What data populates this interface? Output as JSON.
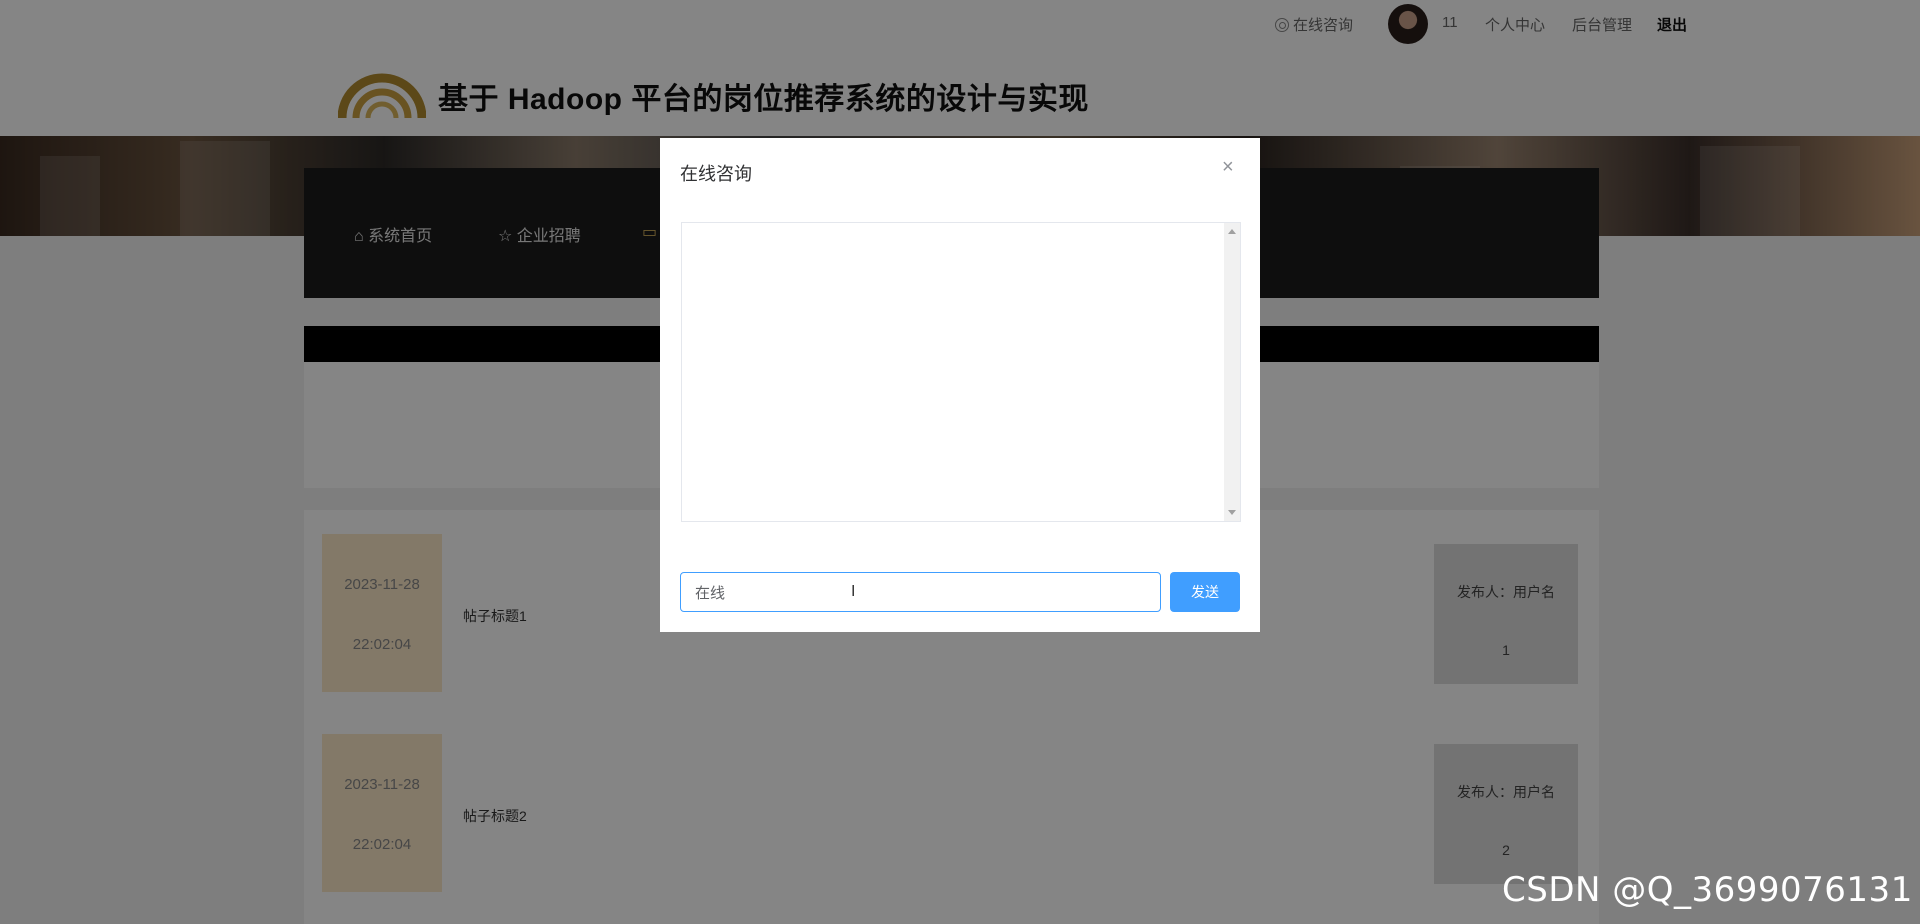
{
  "topbar": {
    "consult": "在线咨询",
    "username": "11",
    "personal_center": "个人中心",
    "admin": "后台管理",
    "logout": "退出"
  },
  "header": {
    "title": "基于 Hadoop 平台的岗位推荐系统的设计与实现"
  },
  "nav": {
    "items": [
      {
        "label": "系统首页",
        "icon": "home-icon"
      },
      {
        "label": "企业招聘",
        "icon": "star-icon"
      }
    ]
  },
  "posts": [
    {
      "date": "2023-11-28",
      "time": "22:02:04",
      "title": "帖子标题1",
      "author_label": "发布人：用户名",
      "author_value": "1"
    },
    {
      "date": "2023-11-28",
      "time": "22:02:04",
      "title": "帖子标题2",
      "author_label": "发布人：用户名",
      "author_value": "2"
    }
  ],
  "dialog": {
    "title": "在线咨询",
    "close": "×",
    "input_value": "在线",
    "send": "发送"
  },
  "watermark": "CSDN @Q_3699076131",
  "colors": {
    "accent": "#409eff",
    "nav_bg": "#1c1c1c",
    "date_bg": "#fbe8c8"
  }
}
